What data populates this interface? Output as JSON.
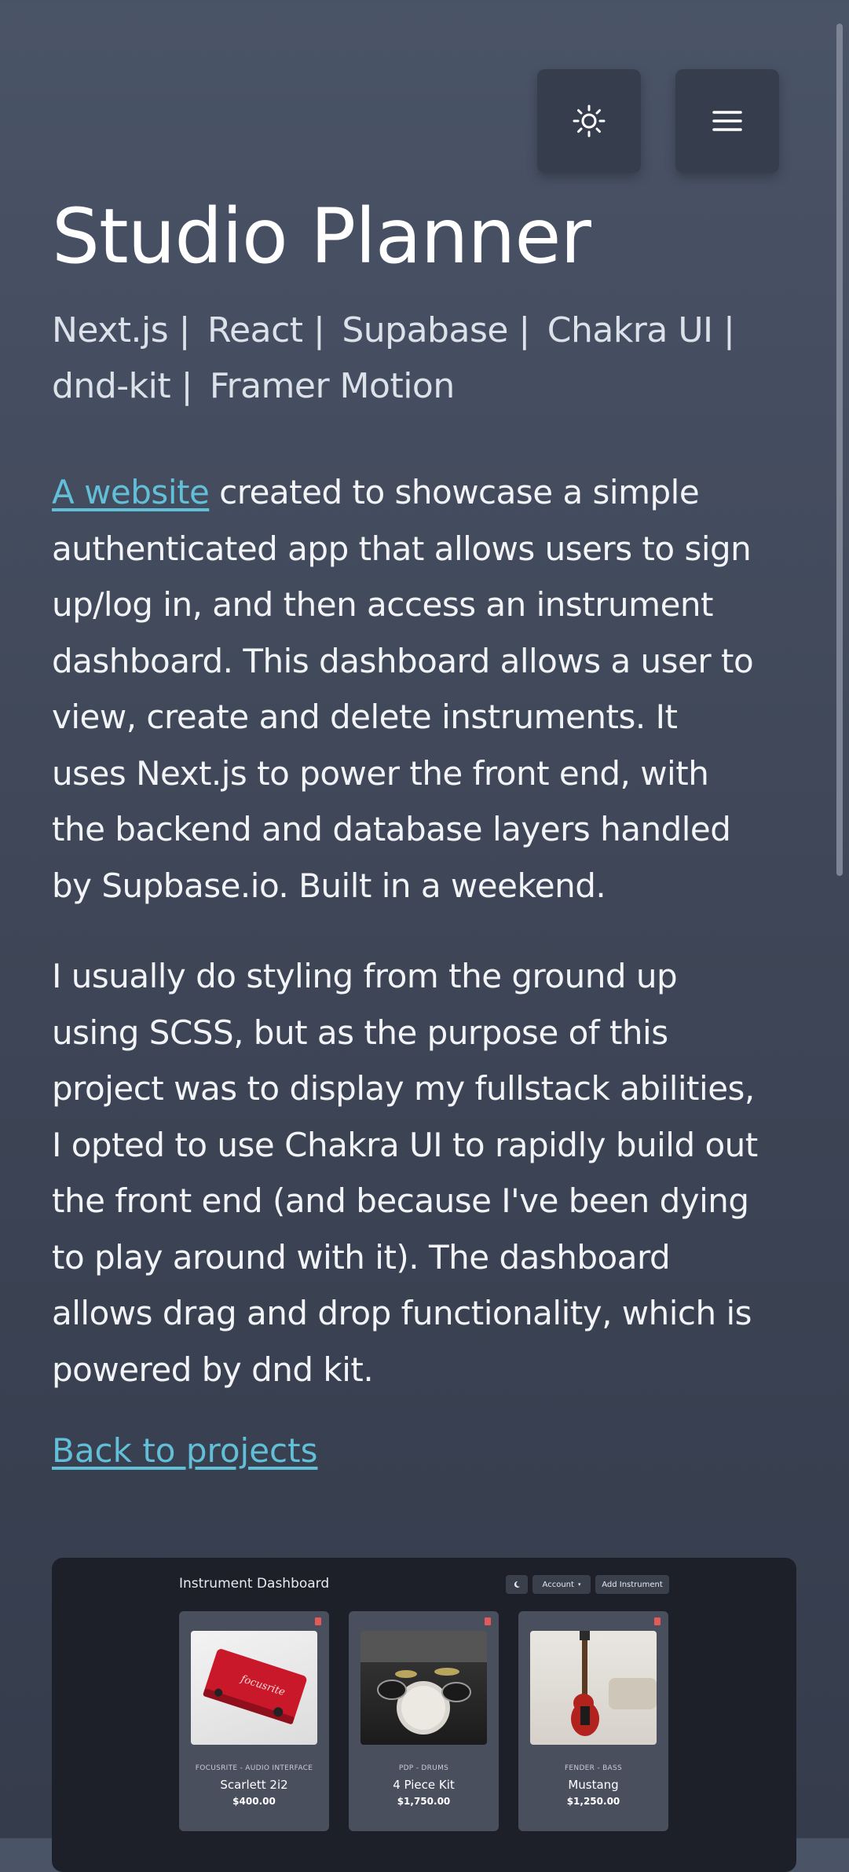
{
  "header": {
    "theme_icon": "sun-icon",
    "menu_icon": "hamburger-menu-icon"
  },
  "project": {
    "title": "Studio Planner",
    "tech": [
      "Next.js |",
      "React |",
      "Supabase |",
      "Chakra UI |",
      "dnd-kit |",
      "Framer Motion"
    ],
    "para1_link": "A website",
    "para1_text": " created to showcase a simple authenticated app that allows users to sign up/log in, and then access an instrument dashboard. This dashboard allows a user to view, create and delete instruments. It uses Next.js to power the front end, with the backend and database layers handled by Supbase.io. Built in a weekend.",
    "para2_text": "I usually do styling from the ground up using SCSS, but as the purpose of this project was to display my fullstack abilities, I opted to use Chakra UI to rapidly build out the front end (and because I've been dying to play around with it). The dashboard allows drag and drop functionality, which is powered by dnd kit.",
    "back_link": "Back to projects"
  },
  "preview": {
    "dashboard_title": "Instrument Dashboard",
    "mode_icon": "moon-icon",
    "account_label": "Account",
    "add_label": "Add Instrument",
    "cards": [
      {
        "category": "FOCUSRITE - AUDIO INTERFACE",
        "name": "Scarlett 2i2",
        "price": "$400.00",
        "brand_text": "focusrite"
      },
      {
        "category": "PDP - DRUMS",
        "name": "4 Piece Kit",
        "price": "$1,750.00"
      },
      {
        "category": "FENDER - BASS",
        "name": "Mustang",
        "price": "$1,250.00"
      }
    ]
  }
}
